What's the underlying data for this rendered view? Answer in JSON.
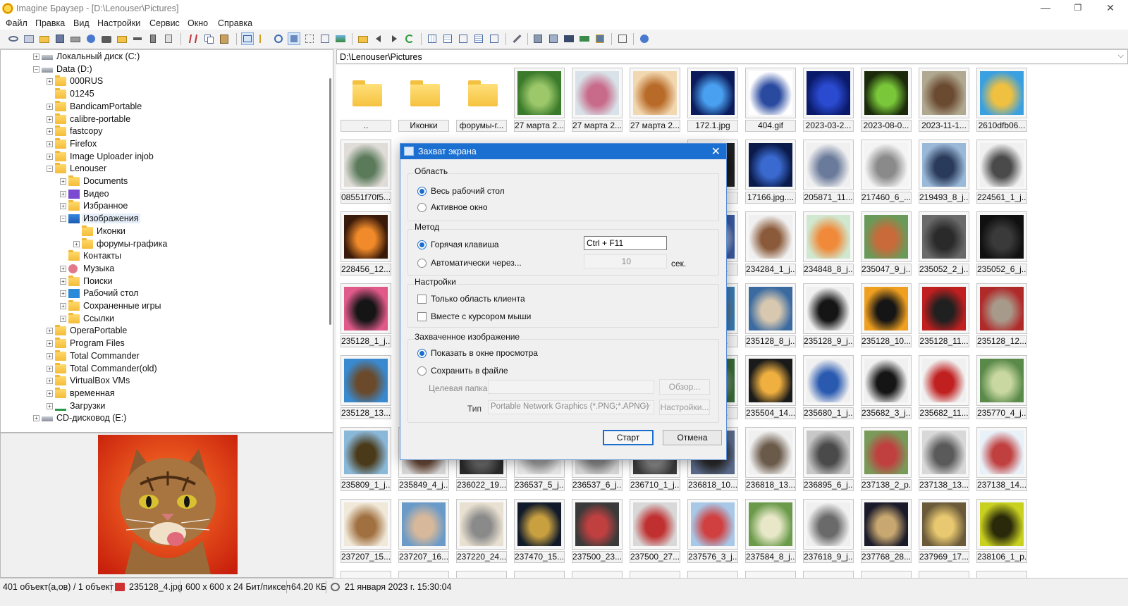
{
  "window": {
    "title": "Imagine Браузер - [D:\\Lenouser\\Pictures]",
    "controls": {
      "minimize": "—",
      "maximize": "❐",
      "close": "✕"
    }
  },
  "menu": [
    "Файл",
    "Правка",
    "Вид",
    "Настройки",
    "Сервис",
    "Окно",
    "Справка"
  ],
  "tree": [
    {
      "label": "Локальный диск (C:)",
      "icon": "drive-icon",
      "exp": "+",
      "level": 0
    },
    {
      "label": "Data (D:)",
      "icon": "drive-icon",
      "exp": "−",
      "level": 0
    },
    {
      "label": "000RUS",
      "icon": "folder-icon",
      "exp": "+",
      "level": 1
    },
    {
      "label": "01245",
      "icon": "folder-icon",
      "exp": "",
      "level": 1
    },
    {
      "label": "BandicamPortable",
      "icon": "folder-icon",
      "exp": "+",
      "level": 1
    },
    {
      "label": "calibre-portable",
      "icon": "folder-icon",
      "exp": "+",
      "level": 1
    },
    {
      "label": "fastcopy",
      "icon": "folder-icon",
      "exp": "+",
      "level": 1
    },
    {
      "label": "Firefox",
      "icon": "folder-icon",
      "exp": "+",
      "level": 1
    },
    {
      "label": "Image Uploader injob",
      "icon": "folder-icon",
      "exp": "+",
      "level": 1
    },
    {
      "label": "Lenouser",
      "icon": "folder-icon",
      "exp": "−",
      "level": 1
    },
    {
      "label": "Documents",
      "icon": "folder-icon",
      "exp": "+",
      "level": 2
    },
    {
      "label": "Видео",
      "icon": "video-folder-icon",
      "exp": "+",
      "level": 2
    },
    {
      "label": "Избранное",
      "icon": "folder-icon",
      "exp": "+",
      "level": 2
    },
    {
      "label": "Изображения",
      "icon": "pictures-folder-icon",
      "exp": "−",
      "level": 2,
      "selected": true
    },
    {
      "label": "Иконки",
      "icon": "folder-icon",
      "exp": "",
      "level": 3
    },
    {
      "label": "форумы-графика",
      "icon": "folder-icon",
      "exp": "+",
      "level": 3
    },
    {
      "label": "Контакты",
      "icon": "folder-icon",
      "exp": "",
      "level": 2
    },
    {
      "label": "Музыка",
      "icon": "music-folder-icon",
      "exp": "+",
      "level": 2
    },
    {
      "label": "Поиски",
      "icon": "folder-icon",
      "exp": "+",
      "level": 2
    },
    {
      "label": "Рабочий стол",
      "icon": "desktop-folder-icon",
      "exp": "+",
      "level": 2
    },
    {
      "label": "Сохраненные игры",
      "icon": "folder-icon",
      "exp": "+",
      "level": 2
    },
    {
      "label": "Ссылки",
      "icon": "folder-icon",
      "exp": "+",
      "level": 2
    },
    {
      "label": "OperaPortable",
      "icon": "folder-icon",
      "exp": "+",
      "level": 1
    },
    {
      "label": "Program Files",
      "icon": "folder-icon",
      "exp": "+",
      "level": 1
    },
    {
      "label": "Total Commander",
      "icon": "folder-icon",
      "exp": "+",
      "level": 1
    },
    {
      "label": "Total Commander(old)",
      "icon": "folder-icon",
      "exp": "+",
      "level": 1
    },
    {
      "label": "VirtualBox VMs",
      "icon": "folder-icon",
      "exp": "+",
      "level": 1
    },
    {
      "label": "временная",
      "icon": "folder-icon",
      "exp": "+",
      "level": 1
    },
    {
      "label": "Загрузки",
      "icon": "downloads-icon",
      "exp": "+",
      "level": 1
    },
    {
      "label": "CD-дисковод (E:)",
      "icon": "cd-drive-icon",
      "exp": "+",
      "level": 0
    }
  ],
  "path": "D:\\Lenouser\\Pictures",
  "thumbnails": [
    [
      {
        "caption": "..",
        "kind": "folder"
      },
      {
        "caption": "Иконки",
        "kind": "folder"
      },
      {
        "caption": "форумы-г...",
        "kind": "folder"
      },
      {
        "caption": "27 марта 2...",
        "colors": [
          "#3a7a2a",
          "#9cc86a"
        ]
      },
      {
        "caption": "27 марта 2...",
        "colors": [
          "#d8e2e8",
          "#c86a8a"
        ]
      },
      {
        "caption": "27 марта 2...",
        "colors": [
          "#f2d8b0",
          "#b86a28"
        ]
      },
      {
        "caption": "172.1.jpg",
        "colors": [
          "#0a1a5a",
          "#4aa0f0"
        ]
      },
      {
        "caption": "404.gif",
        "colors": [
          "#ffffff",
          "#2a4aa0"
        ]
      },
      {
        "caption": "2023-03-2...",
        "colors": [
          "#0a1a6a",
          "#2a4ad0"
        ]
      },
      {
        "caption": "2023-08-0...",
        "colors": [
          "#1a2a0a",
          "#7ac83a"
        ]
      },
      {
        "caption": "2023-11-1...",
        "colors": [
          "#b0a890",
          "#6a4a30"
        ]
      },
      {
        "caption": "2610dfb06...",
        "colors": [
          "#3aa0e0",
          "#f0c040"
        ]
      }
    ],
    [
      {
        "caption": "08551f70f5...",
        "colors": [
          "#e0dcd8",
          "#5a7a5a"
        ]
      },
      {
        "caption": "",
        "kind": "hidden"
      },
      {
        "caption": "",
        "kind": "hidden"
      },
      {
        "caption": "",
        "kind": "hidden"
      },
      {
        "caption": "",
        "kind": "hidden"
      },
      {
        "caption": "",
        "kind": "hidden"
      },
      {
        "caption": "...jpg",
        "colors": [
          "#202020",
          "#101010"
        ]
      },
      {
        "caption": "17166.jpg....",
        "colors": [
          "#0a1a4a",
          "#3a6ad0"
        ]
      },
      {
        "caption": "205871_11...",
        "colors": [
          "#f0f0f0",
          "#6a7a9a"
        ]
      },
      {
        "caption": "217460_6_...",
        "colors": [
          "#f4f4f4",
          "#8a8a8a"
        ]
      },
      {
        "caption": "219493_8_j...",
        "colors": [
          "#9ab8d8",
          "#2a3a5a"
        ]
      },
      {
        "caption": "224561_1_j...",
        "colors": [
          "#f0f0f0",
          "#4a4a4a"
        ]
      }
    ],
    [
      {
        "caption": "228456_12...",
        "colors": [
          "#3a1a0a",
          "#f08a2a"
        ]
      },
      {
        "caption": "",
        "kind": "hidden"
      },
      {
        "caption": "",
        "kind": "hidden"
      },
      {
        "caption": "",
        "kind": "hidden"
      },
      {
        "caption": "",
        "kind": "hidden"
      },
      {
        "caption": "",
        "kind": "hidden"
      },
      {
        "caption": "..._8_j...",
        "colors": [
          "#3a5aa0",
          "#d8d8d8"
        ]
      },
      {
        "caption": "234284_1_j...",
        "colors": [
          "#f0f0f0",
          "#8a5a3a"
        ]
      },
      {
        "caption": "234848_8_j...",
        "colors": [
          "#d0e8d0",
          "#f08a3a"
        ]
      },
      {
        "caption": "235047_9_j...",
        "colors": [
          "#6a9a5a",
          "#c86a3a"
        ]
      },
      {
        "caption": "235052_2_j...",
        "colors": [
          "#6a6a6a",
          "#2a2a2a"
        ]
      },
      {
        "caption": "235052_6_j...",
        "colors": [
          "#101010",
          "#3a3a3a"
        ]
      }
    ],
    [
      {
        "caption": "235128_1_j...",
        "colors": [
          "#e05a8a",
          "#151515"
        ]
      },
      {
        "caption": "",
        "kind": "hidden"
      },
      {
        "caption": "",
        "kind": "hidden"
      },
      {
        "caption": "",
        "kind": "hidden"
      },
      {
        "caption": "",
        "kind": "hidden"
      },
      {
        "caption": "",
        "kind": "hidden"
      },
      {
        "caption": "..._7_j...",
        "colors": [
          "#3a7ab0",
          "#6a6a6a"
        ]
      },
      {
        "caption": "235128_8_j...",
        "colors": [
          "#3a6aa0",
          "#d8c8b0"
        ]
      },
      {
        "caption": "235128_9_j...",
        "colors": [
          "#f0f0f0",
          "#151515"
        ]
      },
      {
        "caption": "235128_10...",
        "colors": [
          "#f0a020",
          "#151515"
        ]
      },
      {
        "caption": "235128_11...",
        "colors": [
          "#c02020",
          "#202020"
        ]
      },
      {
        "caption": "235128_12...",
        "colors": [
          "#b02a2a",
          "#a89a8a"
        ]
      }
    ],
    [
      {
        "caption": "235128_13...",
        "colors": [
          "#3a8ad0",
          "#6a4a2a"
        ]
      },
      {
        "caption": "",
        "kind": "hidden"
      },
      {
        "caption": "",
        "kind": "hidden"
      },
      {
        "caption": "",
        "kind": "hidden"
      },
      {
        "caption": "",
        "kind": "hidden"
      },
      {
        "caption": "",
        "kind": "hidden"
      },
      {
        "caption": "..._8_j...",
        "colors": [
          "#3a6a3a",
          "#8aa08a"
        ]
      },
      {
        "caption": "235504_14...",
        "colors": [
          "#1a1a1a",
          "#f0b040"
        ]
      },
      {
        "caption": "235680_1_j...",
        "colors": [
          "#f0f0f0",
          "#2a5ab0"
        ]
      },
      {
        "caption": "235682_3_j...",
        "colors": [
          "#f0f0f0",
          "#151515"
        ]
      },
      {
        "caption": "235682_11...",
        "colors": [
          "#f0f0f0",
          "#c02020"
        ]
      },
      {
        "caption": "235770_4_j...",
        "colors": [
          "#5a8a4a",
          "#c8d8a0"
        ]
      }
    ],
    [
      {
        "caption": "235809_1_j...",
        "colors": [
          "#8ab8d8",
          "#4a3a1a"
        ]
      },
      {
        "caption": "235849_4_j...",
        "colors": [
          "#d8d8d8",
          "#6a4a3a"
        ]
      },
      {
        "caption": "236022_19...",
        "colors": [
          "#2a2a2a",
          "#6a6a6a"
        ]
      },
      {
        "caption": "236537_5_j...",
        "colors": [
          "#e8e8e8",
          "#a0a0a0"
        ]
      },
      {
        "caption": "236537_6_j...",
        "colors": [
          "#d8d8d8",
          "#8a8a8a"
        ]
      },
      {
        "caption": "236710_1_j...",
        "colors": [
          "#3a3a3a",
          "#8a8a8a"
        ]
      },
      {
        "caption": "236818_10...",
        "colors": [
          "#5a6a8a",
          "#2a2a2a"
        ]
      },
      {
        "caption": "236818_13...",
        "colors": [
          "#f0f0f0",
          "#6a5a4a"
        ]
      },
      {
        "caption": "236895_6_j...",
        "colors": [
          "#c8c8c8",
          "#4a4a4a"
        ]
      },
      {
        "caption": "237138_2_p...",
        "colors": [
          "#7a9a5a",
          "#c04040"
        ]
      },
      {
        "caption": "237138_13...",
        "colors": [
          "#d8d8d8",
          "#5a5a5a"
        ]
      },
      {
        "caption": "237138_14...",
        "colors": [
          "#e8f0f8",
          "#c04040"
        ]
      }
    ],
    [
      {
        "caption": "237207_15...",
        "colors": [
          "#f0e8d8",
          "#a07040"
        ]
      },
      {
        "caption": "237207_16...",
        "colors": [
          "#6a9ac8",
          "#d8b89a"
        ]
      },
      {
        "caption": "237220_24...",
        "colors": [
          "#e8e0d0",
          "#8a8a8a"
        ]
      },
      {
        "caption": "237470_15...",
        "colors": [
          "#101a2a",
          "#c8a040"
        ]
      },
      {
        "caption": "237500_23...",
        "colors": [
          "#3a3a3a",
          "#c04040"
        ]
      },
      {
        "caption": "237500_27...",
        "colors": [
          "#d8d8d8",
          "#c03030"
        ]
      },
      {
        "caption": "237576_3_j...",
        "colors": [
          "#a8c8e8",
          "#d04040"
        ]
      },
      {
        "caption": "237584_8_j...",
        "colors": [
          "#6a9a4a",
          "#e8e8c8"
        ]
      },
      {
        "caption": "237618_9_j...",
        "colors": [
          "#f0f0f0",
          "#6a6a6a"
        ]
      },
      {
        "caption": "237768_28...",
        "colors": [
          "#1a1a2a",
          "#c8a870"
        ]
      },
      {
        "caption": "237969_17...",
        "colors": [
          "#6a5a3a",
          "#e8c870"
        ]
      },
      {
        "caption": "238106_1_p...",
        "colors": [
          "#c8d020",
          "#2a2a0a"
        ]
      }
    ]
  ],
  "status": {
    "count": "401 объект(а,ов) / 1 объект",
    "file": "235128_4.jpg",
    "dims": "600 x 600 x 24 Бит/пиксел",
    "size": "64.20 КБ",
    "date": "21 января 2023 г. 15:30:04"
  },
  "dialog": {
    "title": "Захват экрана",
    "close": "✕",
    "area": {
      "title": "Область",
      "options": [
        "Весь рабочий стол",
        "Активное окно"
      ],
      "selected": 0
    },
    "method": {
      "title": "Метод",
      "hotkey_label": "Горячая клавиша",
      "hotkey_value": "Ctrl + F11",
      "auto_label": "Автоматически через...",
      "auto_value": "10",
      "auto_unit": "сек.",
      "selected": 0
    },
    "settings": {
      "title": "Настройки",
      "client_only": "Только область клиента",
      "with_cursor": "Вместе с курсором мыши"
    },
    "captured": {
      "title": "Захваченное изображение",
      "show_preview": "Показать в окне просмотра",
      "save_file": "Сохранить в файле",
      "target_folder_label": "Целевая папка",
      "browse": "Обзор...",
      "type_label": "Тип",
      "type_value": "Portable Network Graphics (*.PNG;*.APNG)",
      "settings_button": "Настройки...",
      "selected": 0
    },
    "start": "Старт",
    "cancel": "Отмена"
  }
}
